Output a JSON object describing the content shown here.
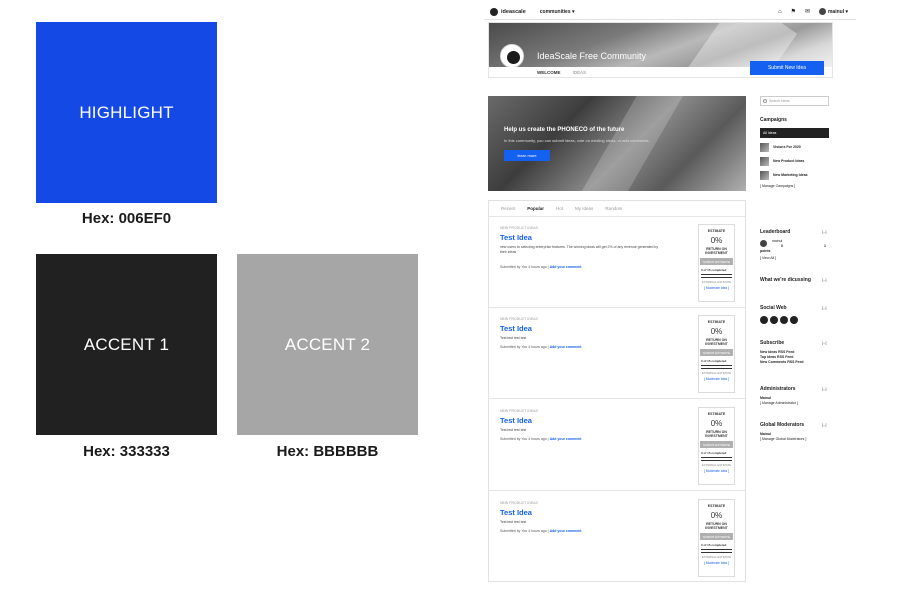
{
  "swatches": {
    "highlight": {
      "label": "HIGHLIGHT",
      "hex": "Hex: 006EF0",
      "color": "#006EF0"
    },
    "accent1": {
      "label": "ACCENT 1",
      "hex": "Hex: 333333",
      "color": "#333333"
    },
    "accent2": {
      "label": "ACCENT 2",
      "hex": "Hex: BBBBBB",
      "color": "#BBBBBB"
    }
  },
  "mockup": {
    "topbar": {
      "brand": "ideascale",
      "communities": "communities ▾",
      "user": "mainul ▾"
    },
    "header": {
      "title": "IdeaScale Free Community",
      "submit": "Submit New Idea",
      "tabs": [
        "WELCOME",
        "IDEAS"
      ]
    },
    "banner": {
      "title": "Help us create the PHONECO of the future",
      "subtitle": "In this community, you can submit ideas, vote on existing ideas, or add comments.",
      "button": "learn more"
    },
    "sort_tabs": [
      "Recent",
      "Popular",
      "Hot",
      "My Ideas",
      "Random"
    ],
    "ideas": [
      {
        "category": "NEW PRODUCT IDEAS",
        "title": "Test Idea",
        "desc": "new users to selecting enterprise features. The winning ideas will get 2% of any revenue generated by their ideas",
        "by": "Submitted by You 4 hours ago |",
        "comment": "Add your comment",
        "estimate": "ESTIMATE",
        "pct": "0%",
        "roi": "RETURN ON INVESTMENT",
        "submit_est": "SUBMIT ESTIMATE",
        "progress": "0 of 15 completed",
        "ext": "EXTERNAL ESTIMATE",
        "moderate": "[ Moderate Idea ]"
      },
      {
        "category": "NEW PRODUCT IDEAS",
        "title": "Test Idea",
        "desc": "Test test test test",
        "by": "Submitted by You 4 hours ago |",
        "comment": "Add your comment",
        "estimate": "ESTIMATE",
        "pct": "0%",
        "roi": "RETURN ON INVESTMENT",
        "submit_est": "SUBMIT ESTIMATE",
        "progress": "0 of 15 completed",
        "ext": "EXTERNAL ESTIMATE",
        "moderate": "[ Moderate Idea ]"
      },
      {
        "category": "NEW PRODUCT IDEAS",
        "title": "Test Idea",
        "desc": "Test test test test",
        "by": "Submitted by You 4 hours ago |",
        "comment": "Add your comment",
        "estimate": "ESTIMATE",
        "pct": "0%",
        "roi": "RETURN ON INVESTMENT",
        "submit_est": "SUBMIT ESTIMATE",
        "progress": "0 of 15 completed",
        "ext": "EXTERNAL ESTIMATE",
        "moderate": "[ Moderate Idea ]"
      },
      {
        "category": "NEW PRODUCT IDEAS",
        "title": "Test Idea",
        "desc": "Test test test test",
        "by": "Submitted by You 4 hours ago |",
        "comment": "Add your comment",
        "estimate": "ESTIMATE",
        "pct": "0%",
        "roi": "RETURN ON INVESTMENT",
        "submit_est": "SUBMIT ESTIMATE",
        "progress": "0 of 15 completed",
        "ext": "EXTERNAL ESTIMATE",
        "moderate": "[ Moderate Idea ]"
      }
    ],
    "sidebar": {
      "search_placeholder": "Search Ideas",
      "campaigns_title": "Campaigns",
      "campaigns": [
        "All Ideas",
        "Visions For 2020",
        "New Product Ideas",
        "New Marketing Ideas"
      ],
      "manage_campaigns": "[ Manage Campaigns ]",
      "leaderboard": "Leaderboard",
      "leader_name": "mainul",
      "leader_points": "0 points",
      "leader_rank": "1",
      "view_all": "[ View All ]",
      "discussing": "What we're dicussing",
      "social": "Social Web",
      "subscribe": "Subscribe",
      "feeds": [
        "New Ideas RSS Feed",
        "Top Ideas RSS Feed",
        "New Comments RSS Feed"
      ],
      "admins": "Administrators",
      "admin_name": "Mainul",
      "manage_admins": "[ Manage Administrator ]",
      "mods": "Global Moderators",
      "mod_name": "Mainul",
      "manage_mods": "[ Manage Global Moderators ]",
      "toggle": "[–]"
    }
  }
}
